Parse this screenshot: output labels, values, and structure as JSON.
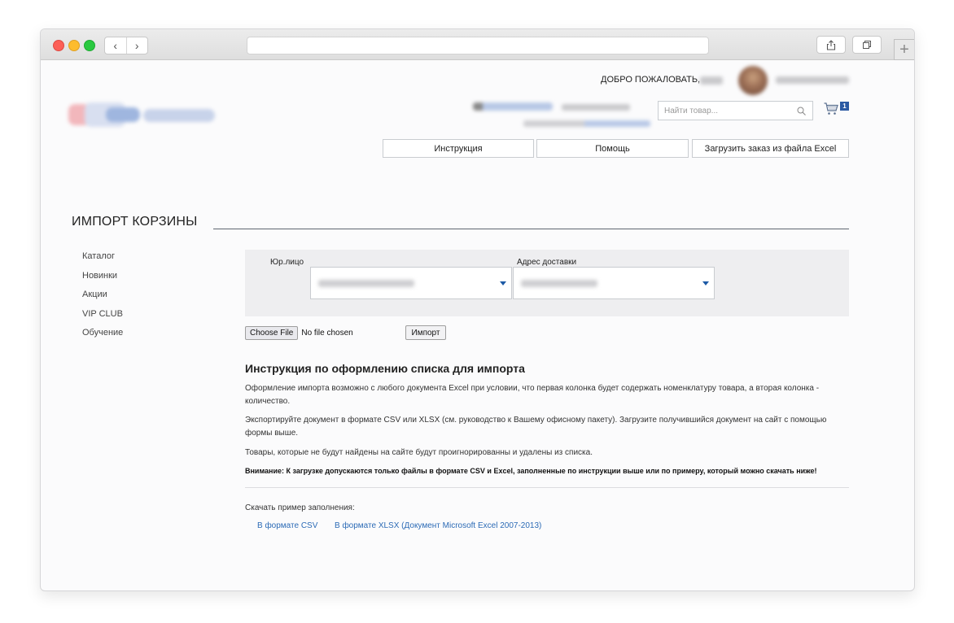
{
  "header": {
    "welcome_text": "ДОБРО ПОЖАЛОВАТЬ,"
  },
  "search": {
    "placeholder": "Найти товар..."
  },
  "cart": {
    "count": "1"
  },
  "top_buttons": {
    "instruction": "Инструкция",
    "help": "Помощь",
    "upload_excel": "Загрузить заказ из файла Excel"
  },
  "page": {
    "title": "ИМПОРТ КОРЗИНЫ"
  },
  "sidebar": {
    "items": [
      {
        "label": "Каталог"
      },
      {
        "label": "Новинки"
      },
      {
        "label": "Акции"
      },
      {
        "label": "VIP CLUB"
      },
      {
        "label": "Обучение"
      }
    ]
  },
  "filters": {
    "legal_entity_label": "Юр.лицо",
    "delivery_address_label": "Адрес доставки"
  },
  "file_upload": {
    "choose_label": "Choose File",
    "status": "No file chosen",
    "import_label": "Импорт"
  },
  "instructions": {
    "title": "Инструкция по оформлению списка для импорта",
    "p1": "Оформление импорта возможно с любого документа Excel при условии, что первая колонка будет содержать номенклатуру товара, а вторая колонка - количество.",
    "p2": "Экспортируйте документ в формате CSV или XLSX (см. руководство к Вашему офисному пакету). Загрузите получившийся документ на сайт с помощью формы выше.",
    "p3": "Товары, которые не будут найдены на сайте будут проигнорированны и удалены из списка.",
    "warning": "Внимание: К загрузке допускаются только файлы в формате CSV и Excel, заполненные по инструкции выше или по примеру, который можно скачать ниже!"
  },
  "download": {
    "label": "Скачать пример заполнения:",
    "csv_link": "В формате CSV",
    "xlsx_link": "В формате XLSX (Документ Microsoft Excel 2007-2013)"
  },
  "colors": {
    "accent": "#2c6bb6",
    "badge": "#2b5aa3",
    "panel": "#eeeef0"
  }
}
